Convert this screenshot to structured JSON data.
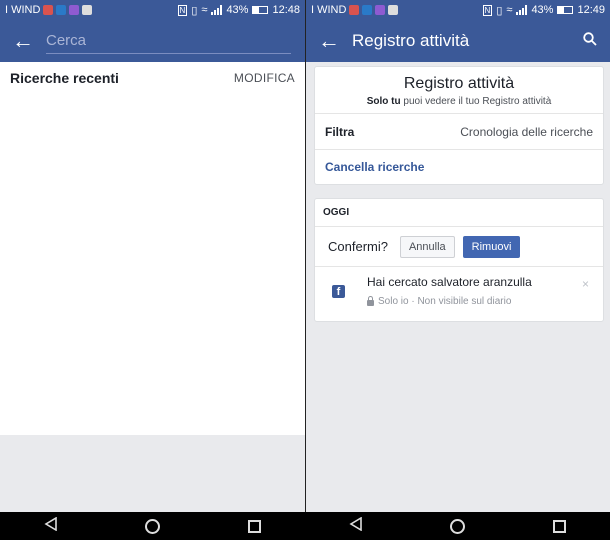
{
  "left": {
    "status": {
      "carrier": "I WIND",
      "battery": "43%",
      "time": "12:48"
    },
    "search": {
      "placeholder": "Cerca"
    },
    "recent": {
      "title": "Ricerche recenti",
      "edit": "MODIFICA"
    }
  },
  "right": {
    "status": {
      "carrier": "I WIND",
      "battery": "43%",
      "time": "12:49"
    },
    "appbar": {
      "title": "Registro attività"
    },
    "header": {
      "title": "Registro attività",
      "subtitle_bold": "Solo tu",
      "subtitle_rest": " puoi vedere il tuo Registro attività"
    },
    "filter": {
      "label": "Filtra",
      "value": "Cronologia delle ricerche"
    },
    "clear": "Cancella ricerche",
    "section": "OGGI",
    "confirm": {
      "label": "Confermi?",
      "cancel": "Annulla",
      "remove": "Rimuovi"
    },
    "entry": {
      "title": "Hai cercato salvatore aranzulla",
      "meta": "Solo io · Non visibile sul diario",
      "close": "×"
    }
  },
  "colors": {
    "brand": "#3b5998",
    "button": "#4267b2",
    "link": "#365899"
  },
  "icons": {
    "back": "arrow-left-icon",
    "search": "search-icon",
    "facebook": "facebook-icon",
    "lock": "lock-icon",
    "close": "close-icon"
  }
}
